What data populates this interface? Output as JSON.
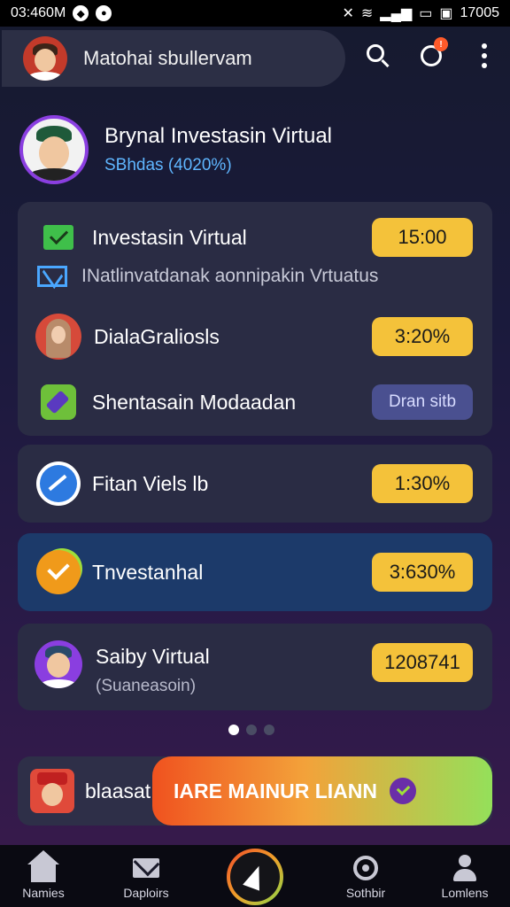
{
  "status_bar": {
    "time_left": "03:460M",
    "time_right": "17005"
  },
  "header": {
    "user_name": "Matohai sbullervam"
  },
  "profile": {
    "title": "Brynal Investasin Virtual",
    "subtitle": "SBhdas (4020%)"
  },
  "card1": {
    "row1": {
      "label": "Investasin Virtual",
      "value": "15:00"
    },
    "sub_text": "INatlinvatdanak aonnipakin Vrtuatus",
    "row2": {
      "label": "DialaGraliosls",
      "value": "3:20%"
    },
    "row3": {
      "label": "Shentasain Modaadan",
      "value": "Dran sitb"
    }
  },
  "card2": {
    "label": "Fitan Viels lb",
    "value": "1:30%"
  },
  "card3": {
    "label": "Tnvestanhal",
    "value": "3:630%"
  },
  "card4": {
    "label": "Saiby Virtual",
    "sub": "(Suaneasoin)",
    "value": "1208741"
  },
  "promo": {
    "label": "blaasat",
    "banner_text": "IARE MAINUR LIANN"
  },
  "bottom_nav": [
    {
      "label": "Namies"
    },
    {
      "label": "Daploirs"
    },
    {
      "label": ""
    },
    {
      "label": "Sothbir"
    },
    {
      "label": "Lomlens"
    }
  ],
  "colors": {
    "accent_yellow": "#f4c23a",
    "accent_purple": "#8a3ee0",
    "highlight_card": "#1c3a6a"
  }
}
